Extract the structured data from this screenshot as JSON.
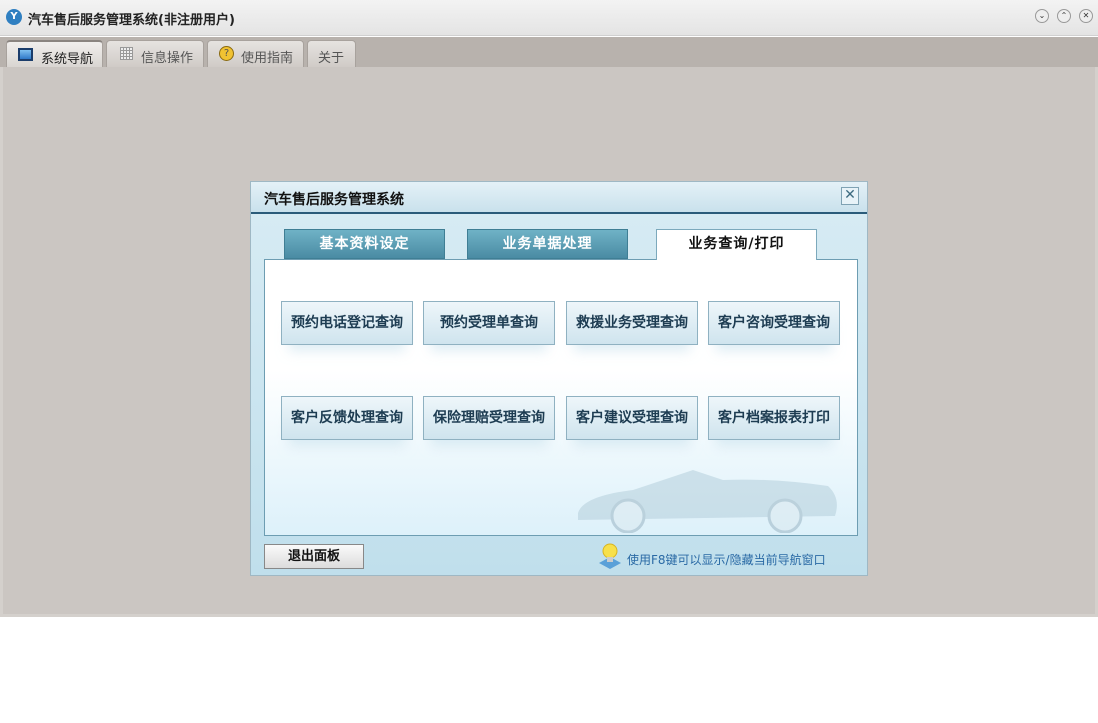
{
  "app": {
    "title": "汽车售后服务管理系统(非注册用户)",
    "icon": "app-logo-icon"
  },
  "window_buttons": [
    "minimize",
    "maximize",
    "close"
  ],
  "main_tabs": [
    {
      "label": "系统导航",
      "icon": "monitor-icon",
      "active": true
    },
    {
      "label": "信息操作",
      "icon": "grid-icon"
    },
    {
      "label": "使用指南",
      "icon": "help-icon"
    },
    {
      "label": "关于"
    }
  ],
  "dialog": {
    "title": "汽车售后服务管理系统",
    "tabs": [
      {
        "label": "基本资料设定"
      },
      {
        "label": "业务单据处理"
      },
      {
        "label": "业务查询/打印",
        "active": true
      }
    ],
    "buttons": [
      "预约电话登记查询",
      "预约受理单查询",
      "救援业务受理查询",
      "客户咨询受理查询",
      "客户反馈处理查询",
      "保险理赔受理查询",
      "客户建议受理查询",
      "客户档案报表打印"
    ],
    "exit_label": "退出面板",
    "hint": "使用F8键可以显示/隐藏当前导航窗口"
  },
  "colors": {
    "accent": "#2a5c7a",
    "tab_inactive": "#4a8ba3",
    "background": "#cbc6c2"
  }
}
